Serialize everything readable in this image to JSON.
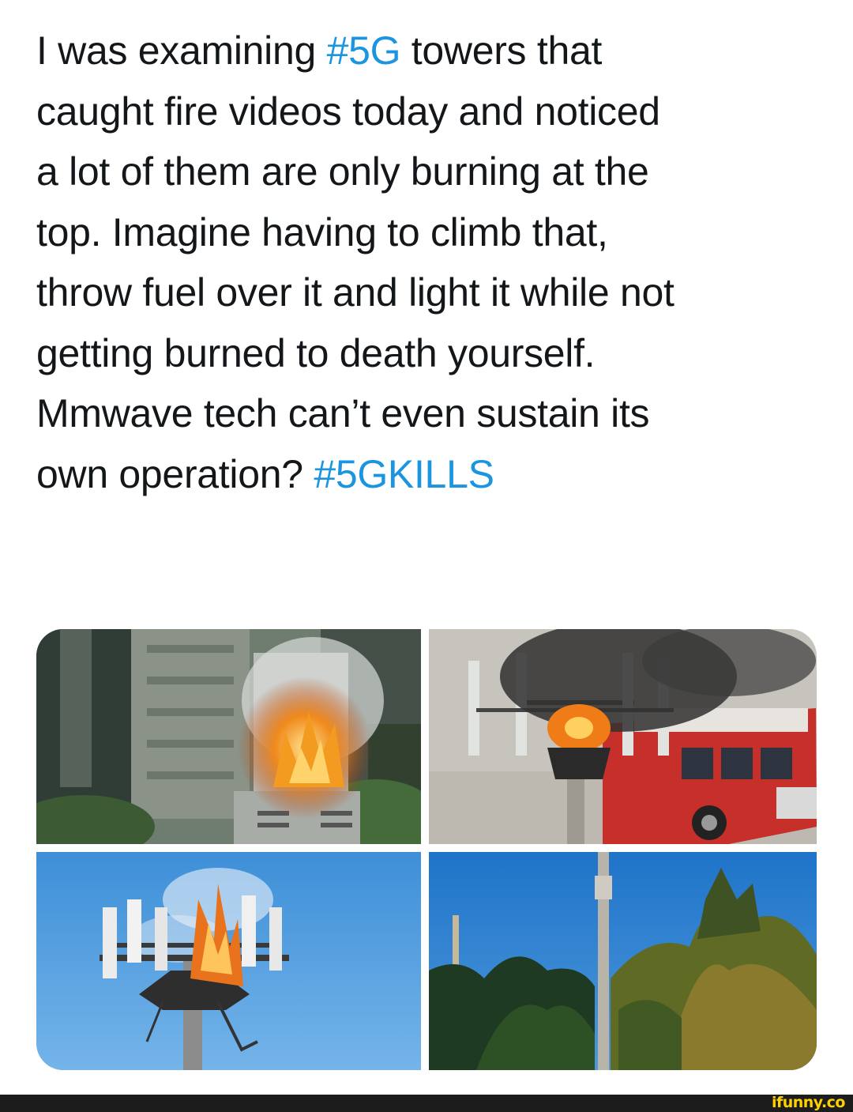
{
  "tweet": {
    "lines": [
      {
        "before": "I was examining ",
        "tag": "#5G",
        "after": " towers that"
      },
      {
        "before": "caught fire videos today and noticed",
        "tag": "",
        "after": ""
      },
      {
        "before": "a lot of them are only burning at the",
        "tag": "",
        "after": ""
      },
      {
        "before": "top. Imagine having to climb that,",
        "tag": "",
        "after": ""
      },
      {
        "before": "throw fuel over it and light it while not",
        "tag": "",
        "after": ""
      },
      {
        "before": "getting burned to death yourself.",
        "tag": "",
        "after": ""
      },
      {
        "before": "Mmwave tech can’t even sustain its",
        "tag": "",
        "after": ""
      },
      {
        "before": "own operation? ",
        "tag": "#5GKILLS",
        "after": ""
      }
    ],
    "hashtag_color": "#1b95e0"
  },
  "photos": [
    {
      "name": "photo-burning-rooftop-antenna"
    },
    {
      "name": "photo-burning-tower-fire-truck"
    },
    {
      "name": "photo-burning-cell-tower-sky"
    },
    {
      "name": "photo-cell-pole-trees"
    }
  ],
  "watermark": {
    "text": "ifunny.co",
    "color": "#ffd100"
  }
}
